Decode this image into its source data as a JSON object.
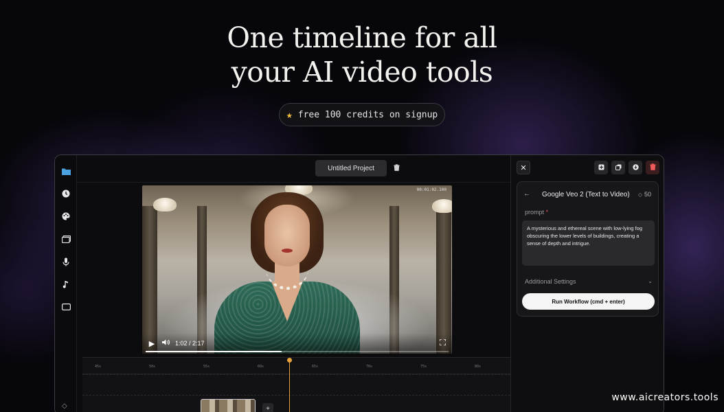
{
  "hero": {
    "title_line1": "One timeline for all",
    "title_line2": "your AI video tools",
    "credits_text": "free 100 credits on signup",
    "credits_icon": "star-icon"
  },
  "sidebar": {
    "icons": [
      "folder-icon",
      "clock-icon",
      "palette-icon",
      "gallery-icon",
      "mic-icon",
      "music-icon",
      "captions-icon",
      "diamond-icon"
    ]
  },
  "toolbar": {
    "project_name": "Untitled Project"
  },
  "video": {
    "timecode": "00:01:02.100",
    "current_time": "1:02 / 2:17",
    "progress": 0.45
  },
  "timeline": {
    "ticks": [
      "45s",
      "50s",
      "55s",
      "60s",
      "65s",
      "70s",
      "75s",
      "80s"
    ],
    "add_label": "+"
  },
  "panel": {
    "model_title": "Google Veo 2 (Text to Video)",
    "cost": "50",
    "prompt_label": "prompt",
    "prompt_required_mark": "*",
    "prompt_value": " A mysterious and ethereal scene with low-lying fog obscuring the lower levels of buildings, creating a sense of depth and intrigue.",
    "additional_settings_label": "Additional Settings",
    "run_button_label": "Run Workflow (cmd + enter)"
  },
  "watermark": "www.aicreators.tools",
  "colors": {
    "accent_playhead": "#e8a23c",
    "danger": "#ef5a5a",
    "star": "#f6c143"
  }
}
